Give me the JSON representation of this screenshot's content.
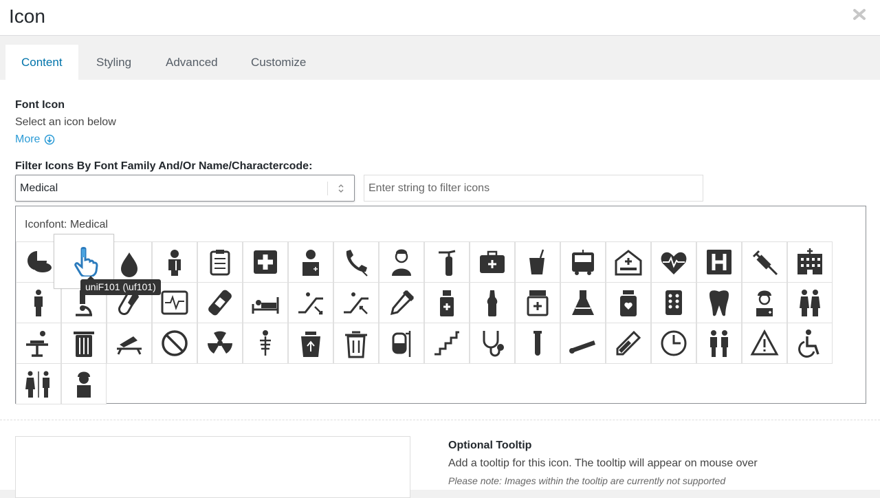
{
  "window": {
    "title": "Icon",
    "close_icon": "close-icon"
  },
  "tabs": [
    {
      "label": "Content",
      "active": true
    },
    {
      "label": "Styling",
      "active": false
    },
    {
      "label": "Advanced",
      "active": false
    },
    {
      "label": "Customize",
      "active": false
    }
  ],
  "font_icon": {
    "label": "Font Icon",
    "description": "Select an icon below",
    "more_label": "More"
  },
  "filter": {
    "label": "Filter Icons By Font Family And/Or Name/Charactercode:",
    "family_value": "Medical",
    "search_placeholder": "Enter string to filter icons"
  },
  "iconfont": {
    "title": "Iconfont: Medical",
    "hover_tooltip": "uniF101 (\\uf101)",
    "icons": [
      "pills-icon",
      "hand-pointer-icon",
      "drop-icon",
      "patient-icon",
      "clipboard-icon",
      "first-aid-icon",
      "doctor-icon",
      "phone-icon",
      "nurse-icon",
      "fire-extinguisher-icon",
      "medical-kit-icon",
      "cup-icon",
      "ambulance-icon",
      "hospital-bed-icon",
      "heart-rate-icon",
      "hospital-h-icon",
      "syringe-icon",
      "hospital-building-icon",
      "man-icon",
      "microscope-icon",
      "capsule-icon",
      "monitor-icon",
      "bandage-icon",
      "bed-icon",
      "escalator-up-icon",
      "escalator-down-icon",
      "pipette-icon",
      "medicine-bottle-icon",
      "ampoule-icon",
      "medicine-jar-icon",
      "flask-icon",
      "pill-bottle-icon",
      "pill-pack-icon",
      "tooth-icon",
      "surgeon-icon",
      "women-icon",
      "operation-icon",
      "trash-can-icon",
      "stretcher-icon",
      "no-entry-icon",
      "radiation-icon",
      "x-ray-icon",
      "recycle-bin-icon",
      "bin-icon",
      "iv-bag-icon",
      "stairs-icon",
      "stethoscope-icon",
      "test-tube-icon",
      "thermometer-stick-icon",
      "thermometer-icon",
      "clock-icon",
      "men-icon",
      "warning-icon",
      "wheelchair-icon",
      "family-restroom-icon",
      "surgeon-bust-icon"
    ]
  },
  "tooltip_section": {
    "label": "Optional Tooltip",
    "description": "Add a tooltip for this icon. The tooltip will appear on mouse over",
    "note": "Please note: Images within the tooltip are currently not supported"
  }
}
